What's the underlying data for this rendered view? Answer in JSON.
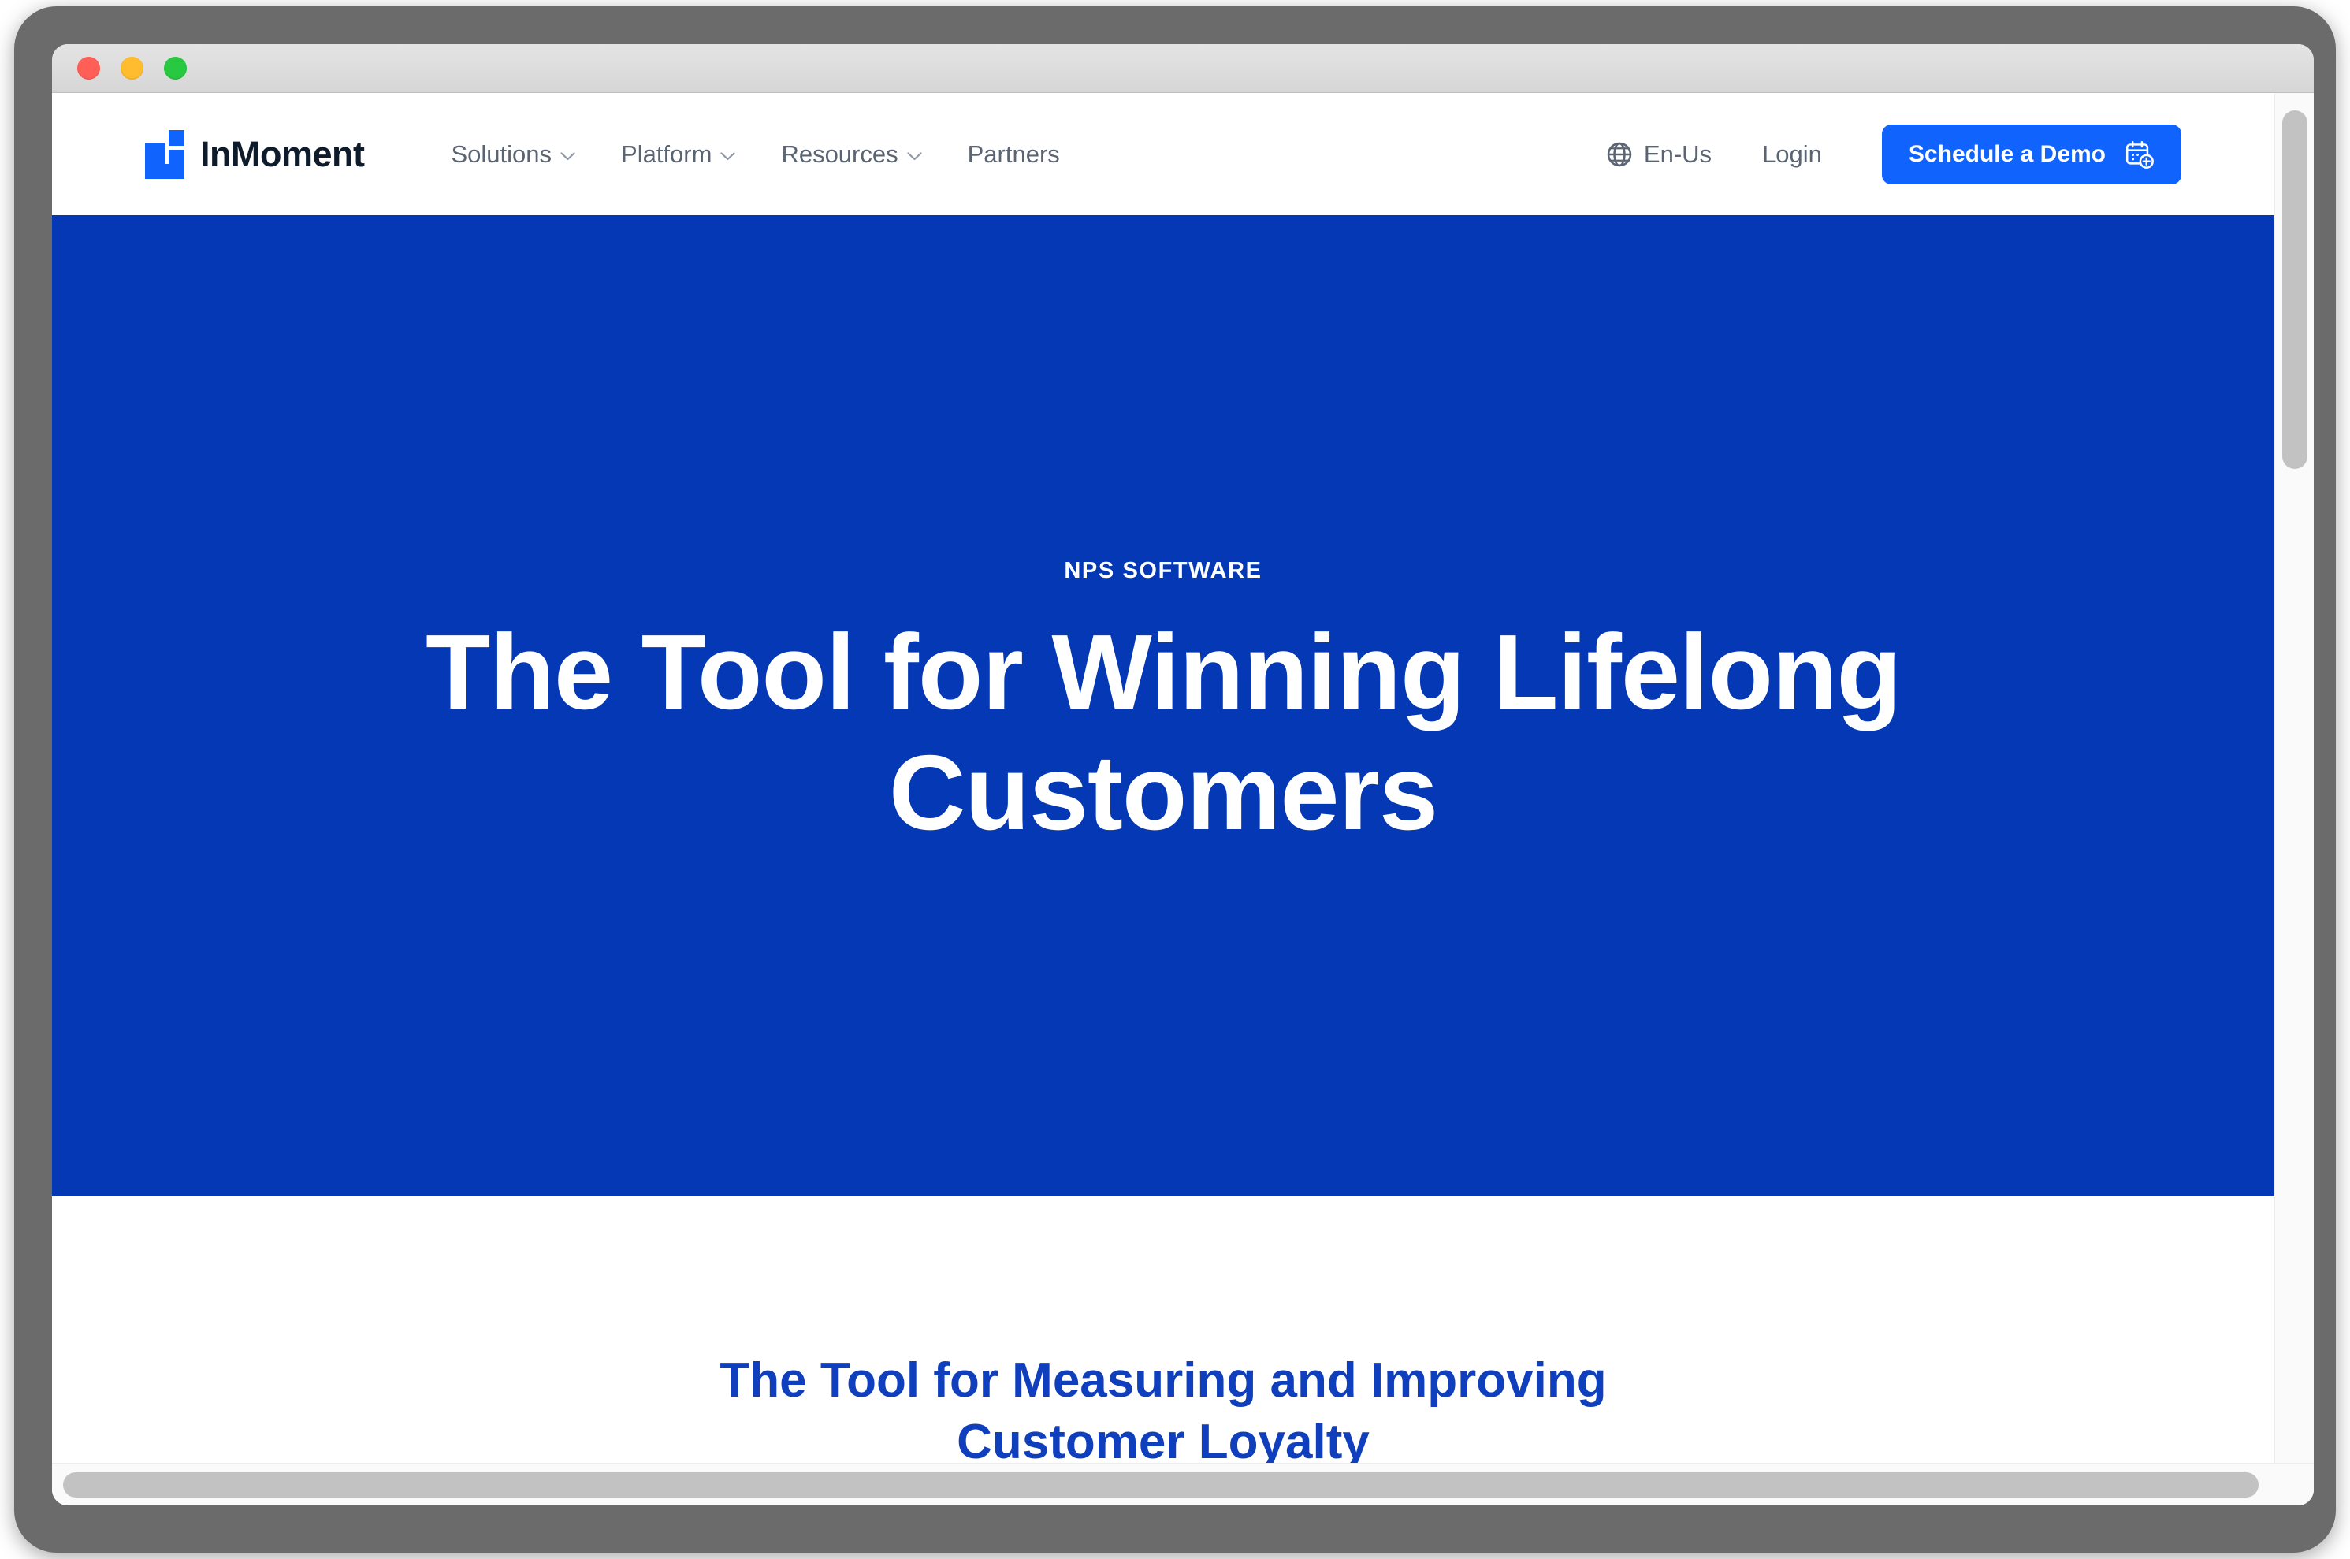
{
  "window": {
    "traffic_lights": [
      {
        "name": "close",
        "color": "#ff5f57"
      },
      {
        "name": "minimize",
        "color": "#febc2e"
      },
      {
        "name": "zoom",
        "color": "#28c840"
      }
    ]
  },
  "header": {
    "logo": {
      "text": "InMoment",
      "mark_color": "#1063fd",
      "text_color": "#0d1b2a"
    },
    "nav": [
      {
        "label": "Solutions",
        "has_dropdown": true
      },
      {
        "label": "Platform",
        "has_dropdown": true
      },
      {
        "label": "Resources",
        "has_dropdown": true
      },
      {
        "label": "Partners",
        "has_dropdown": false
      }
    ],
    "locale": {
      "label": "En-Us",
      "icon": "globe-icon"
    },
    "login": {
      "label": "Login"
    },
    "cta": {
      "label": "Schedule a Demo",
      "icon": "calendar-plus-icon",
      "bg_color": "#1063fd",
      "text_color": "#ffffff"
    }
  },
  "hero": {
    "eyebrow": "NPS SOFTWARE",
    "title_line_1": "The Tool for Winning Lifelong",
    "title_line_2": "Customers",
    "bg_color": "#0438b4",
    "text_color": "#ffffff"
  },
  "section_below": {
    "title_line_1": "The Tool for Measuring and Improving",
    "title_line_2": "Customer Loyalty",
    "text_color": "#0f3fbd",
    "bg_color": "#ffffff"
  }
}
